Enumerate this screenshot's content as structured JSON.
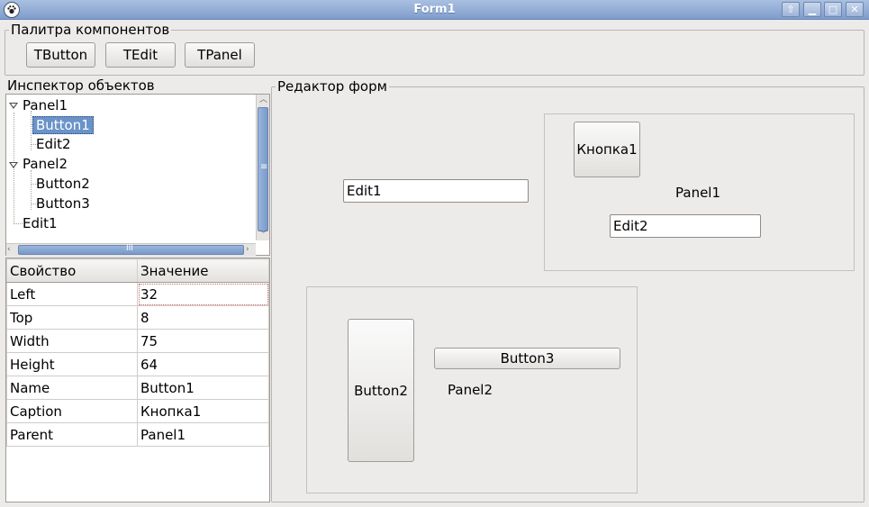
{
  "window": {
    "title": "Form1",
    "buttons": {
      "restore": "⇧",
      "minimize": "▁",
      "maximize": "□",
      "close": "✕"
    }
  },
  "palette": {
    "title": "Палитра компонентов",
    "buttons": [
      "TButton",
      "TEdit",
      "TPanel"
    ]
  },
  "inspector": {
    "title": "Инспектор объектов",
    "tree": [
      {
        "label": "Panel1"
      },
      {
        "label": "Button1"
      },
      {
        "label": "Edit2"
      },
      {
        "label": "Panel2"
      },
      {
        "label": "Button2"
      },
      {
        "label": "Button3"
      },
      {
        "label": "Edit1"
      }
    ],
    "hscroll_glyph": "III",
    "vscroll_glyph": "≡",
    "columns": {
      "property": "Свойство",
      "value": "Значение"
    },
    "rows": [
      {
        "property": "Left",
        "value": "32"
      },
      {
        "property": "Top",
        "value": "8"
      },
      {
        "property": "Width",
        "value": "75"
      },
      {
        "property": "Height",
        "value": "64"
      },
      {
        "property": "Name",
        "value": "Button1"
      },
      {
        "property": "Caption",
        "value": "Кнопка1"
      },
      {
        "property": "Parent",
        "value": "Panel1"
      }
    ]
  },
  "editor": {
    "title": "Редактор форм",
    "edit1": "Edit1",
    "panel1": {
      "caption": "Panel1",
      "button": "Кнопка1",
      "edit": "Edit2"
    },
    "panel2": {
      "caption": "Panel2",
      "button2": "Button2",
      "button3": "Button3"
    }
  },
  "colors": {
    "titlebar": "#8ea8d4",
    "selection": "#6a93c9",
    "background": "#edebe9"
  }
}
